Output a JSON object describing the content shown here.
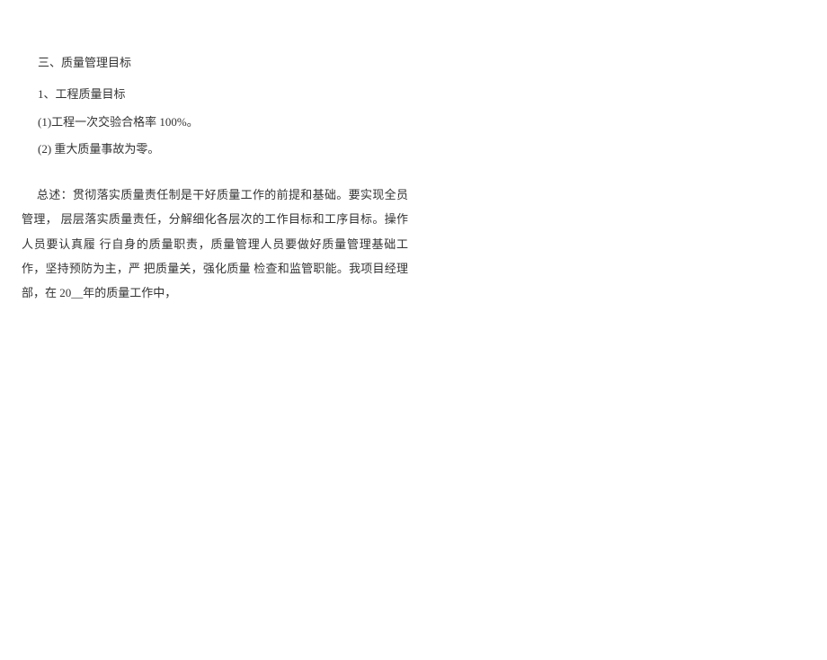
{
  "section": {
    "heading": "三、质量管理目标",
    "sub_heading": "1、工程质量目标",
    "item1": "(1)工程一次交验合格率  100%。",
    "item2": "(2) 重大质量事故为零。",
    "summary": "总述：贯彻落实质量责任制是干好质量工作的前提和基础。要实现全员管理，  层层落实质量责任，分解细化各层次的工作目标和工序目标。操作人员要认真履  行自身的质量职责，质量管理人员要做好质量管理基础工作，坚持预防为主，严  把质量关，强化质量  检查和监管职能。我项目经理部，在  20__年的质量工作中，"
  }
}
